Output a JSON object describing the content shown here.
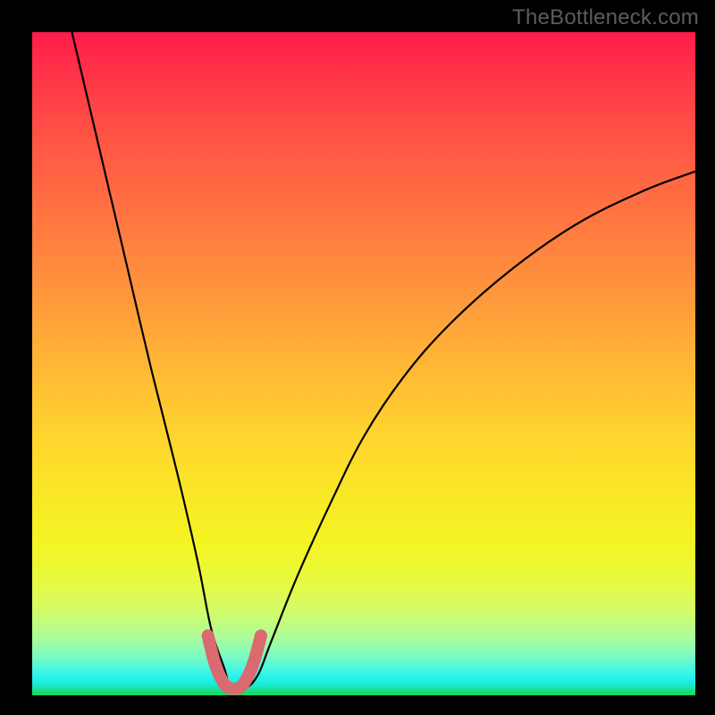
{
  "watermark": "TheBottleneck.com",
  "chart_data": {
    "type": "line",
    "title": "",
    "xlabel": "",
    "ylabel": "",
    "xlim": [
      0,
      100
    ],
    "ylim": [
      0,
      100
    ],
    "grid": false,
    "legend": false,
    "background_gradient_stops": [
      {
        "pct": 0,
        "color": "#ff1c4b"
      },
      {
        "pct": 18,
        "color": "#ff5a44"
      },
      {
        "pct": 40,
        "color": "#ff983c"
      },
      {
        "pct": 60,
        "color": "#ffd22f"
      },
      {
        "pct": 77,
        "color": "#f4f423"
      },
      {
        "pct": 91,
        "color": "#b0fc95"
      },
      {
        "pct": 100,
        "color": "#1cd456"
      }
    ],
    "series": [
      {
        "name": "bottleneck-curve",
        "color": "#000000",
        "x": [
          6,
          10,
          14,
          18,
          22,
          25,
          27,
          29,
          30,
          32,
          34,
          36,
          40,
          45,
          50,
          56,
          63,
          72,
          82,
          92,
          100
        ],
        "y": [
          100,
          83,
          66,
          49,
          33,
          20,
          10,
          4,
          1,
          1,
          3,
          8,
          18,
          29,
          39,
          48,
          56,
          64,
          71,
          76,
          79
        ]
      },
      {
        "name": "optimal-highlight",
        "color": "#d96a6f",
        "x": [
          26.5,
          27.5,
          28.5,
          29.5,
          30.5,
          31.5,
          32.5,
          33.5,
          34.5
        ],
        "y": [
          9,
          5,
          2.5,
          1.2,
          1.0,
          1.3,
          2.8,
          5.3,
          9
        ]
      }
    ],
    "vertex": {
      "x": 30.5,
      "y": 1.0
    }
  }
}
